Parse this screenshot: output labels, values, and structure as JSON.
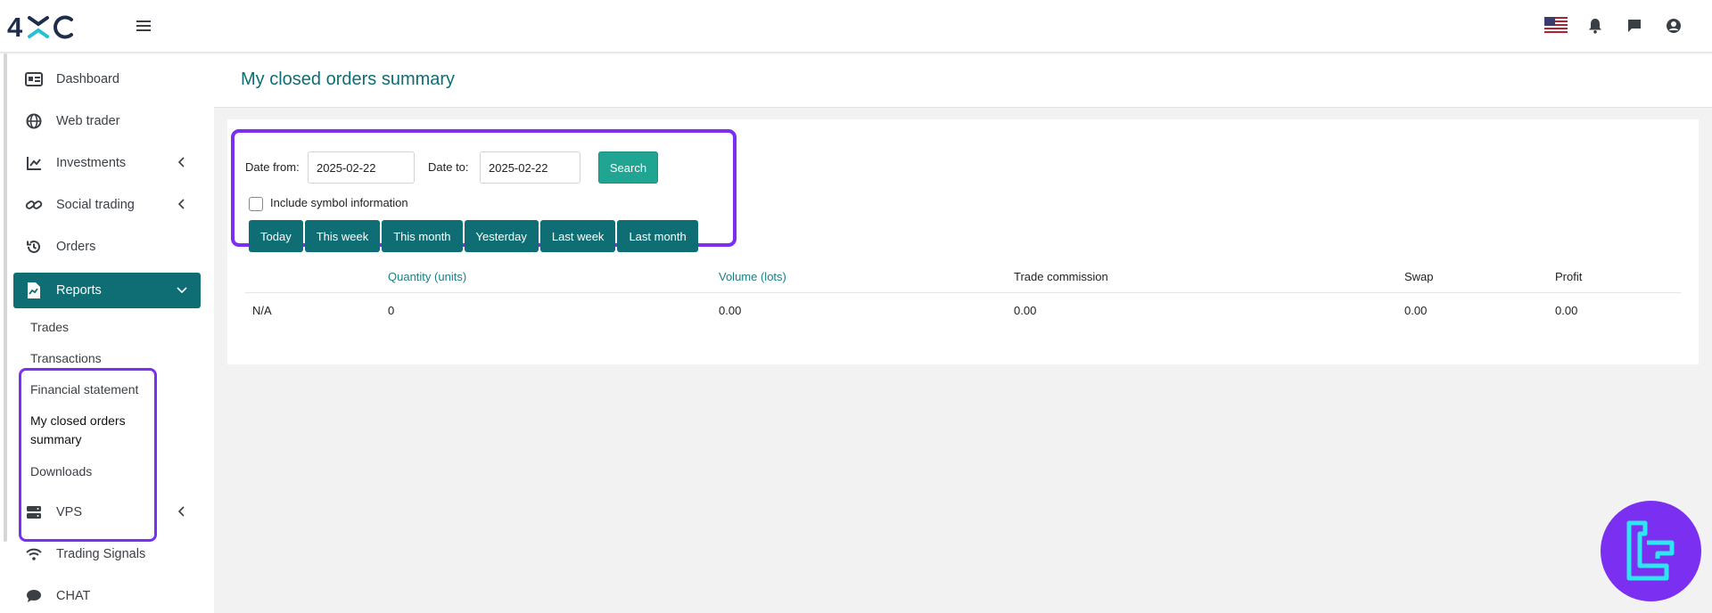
{
  "header": {
    "logo_text": "4XC",
    "icons": [
      "us-flag-icon",
      "bell-icon",
      "chat-icon",
      "user-icon"
    ]
  },
  "sidebar": {
    "items": [
      {
        "label": "Dashboard",
        "icon": "id-card-icon"
      },
      {
        "label": "Web trader",
        "icon": "globe-icon"
      },
      {
        "label": "Investments",
        "icon": "chart-line-icon"
      },
      {
        "label": "Social trading",
        "icon": "link-icon"
      },
      {
        "label": "Orders",
        "icon": "history-icon"
      },
      {
        "label": "Reports",
        "icon": "file-chart-icon"
      },
      {
        "label": "VPS",
        "icon": "server-icon"
      },
      {
        "label": "Trading Signals",
        "icon": "wifi-icon"
      },
      {
        "label": "CHAT",
        "icon": "chat-bubble-icon"
      }
    ],
    "reports_submenu": [
      "Trades",
      "Transactions",
      "Financial statement",
      "My closed orders summary",
      "Downloads"
    ],
    "active_color": "#0e6e74"
  },
  "page": {
    "title": "My closed orders summary"
  },
  "filters": {
    "date_from_label": "Date from:",
    "date_from_value": "2025-02-22",
    "date_to_label": "Date to:",
    "date_to_value": "2025-02-22",
    "search_label": "Search",
    "include_symbol_label": "Include symbol information",
    "include_symbol_checked": false,
    "quick_ranges": [
      "Today",
      "This week",
      "This month",
      "Yesterday",
      "Last week",
      "Last month"
    ]
  },
  "table": {
    "columns": [
      "",
      "Quantity (units)",
      "Volume (lots)",
      "Trade commission",
      "Swap",
      "Profit"
    ],
    "rows": [
      [
        "N/A",
        "0",
        "0.00",
        "0.00",
        "0.00",
        "0.00"
      ]
    ]
  },
  "colors": {
    "accent": "#0e6e74",
    "search": "#21a593",
    "highlight": "#7b2ff0"
  }
}
